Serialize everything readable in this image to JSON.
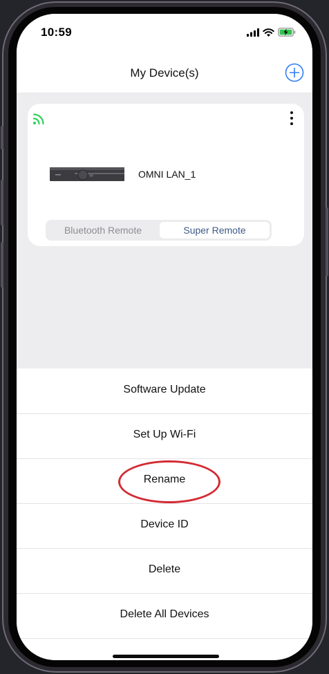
{
  "status_bar": {
    "time": "10:59"
  },
  "header": {
    "title": "My Device(s)"
  },
  "device_card": {
    "name": "OMNI LAN_1",
    "segment": {
      "options": [
        "Bluetooth Remote",
        "Super Remote"
      ],
      "selected": "Super Remote"
    }
  },
  "menu": {
    "items": [
      {
        "label": "Software Update"
      },
      {
        "label": "Set Up Wi-Fi"
      },
      {
        "label": "Rename"
      },
      {
        "label": "Device ID"
      },
      {
        "label": "Delete"
      },
      {
        "label": "Delete All Devices"
      }
    ]
  },
  "colors": {
    "accent": "#2f7cf6",
    "wifi_connected": "#2fd15a",
    "highlight_circle": "#d32b33"
  }
}
